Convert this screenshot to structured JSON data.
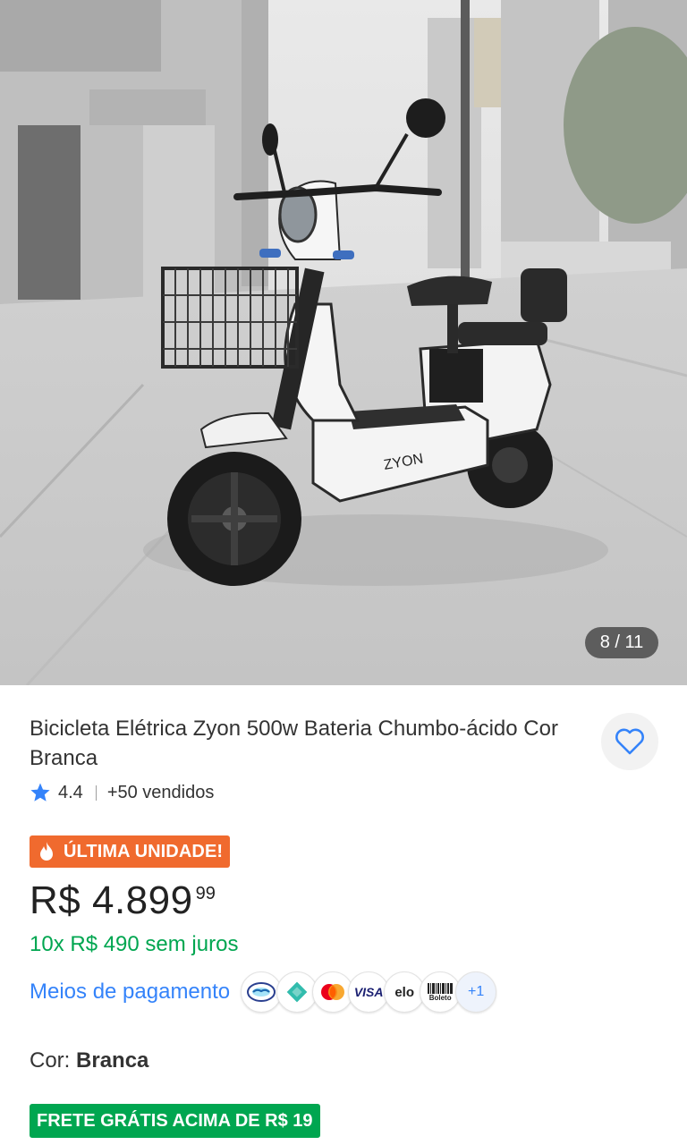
{
  "gallery": {
    "counter": "8 / 11",
    "brand_text": "ZYON",
    "image_alt": "Bicicleta Elétrica Zyon branca"
  },
  "product": {
    "title": "Bicicleta Elétrica Zyon 500w Bateria Chumbo-ácido Cor Branca",
    "rating": "4.4",
    "sold": "+50 vendidos",
    "badge": "ÚLTIMA UNIDADE!",
    "price_main": "R$ 4.899",
    "price_cents": "99",
    "installments": "10x R$ 490 sem juros",
    "payment_label": "Meios de pagamento",
    "payment_methods": [
      "mercado-pago",
      "pix",
      "mastercard",
      "visa",
      "elo",
      "boleto"
    ],
    "payment_more": "+1",
    "boleto_text": "Boleto",
    "visa_text": "VISA",
    "elo_text": "elo",
    "color_label": "Cor: ",
    "color_value": "Branca",
    "shipping": "FRETE GRÁTIS ACIMA DE R$ 19"
  },
  "colors": {
    "accent_blue": "#3483fa",
    "green": "#00a650",
    "badge_orange": "#f06a2e"
  }
}
